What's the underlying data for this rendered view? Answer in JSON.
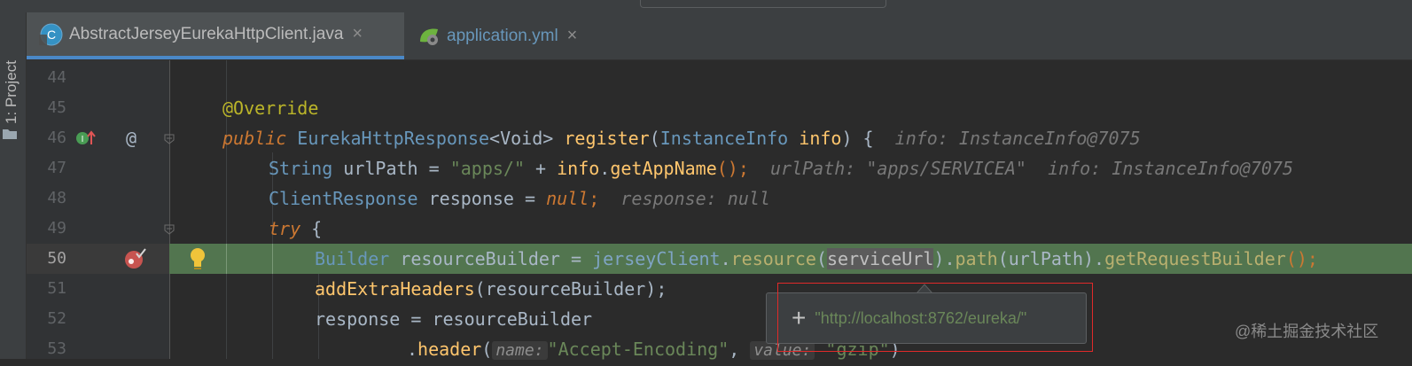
{
  "side": {
    "project_tab": "1: Project"
  },
  "tabs": [
    {
      "label": "AbstractJerseyEurekaHttpClient.java",
      "icon": "java-class-icon",
      "active": true
    },
    {
      "label": "application.yml",
      "icon": "spring-boot-yml-icon",
      "active": false
    }
  ],
  "tab_close": "×",
  "lines": {
    "l44": "44",
    "l45": "45",
    "l46": "46",
    "l47": "47",
    "l48": "48",
    "l49": "49",
    "l50": "50",
    "l51": "51",
    "l52": "52",
    "l53": "53"
  },
  "code": {
    "override": "@Override",
    "l46": {
      "public": "public",
      "type": "EurekaHttpResponse",
      "lt": "<",
      "void": "Void",
      "gt": "> ",
      "name": "register",
      "open": "(",
      "ptype": "InstanceInfo",
      "pname": "info",
      "close": ") {",
      "hint": "info: InstanceInfo@7075"
    },
    "l47": {
      "type": "String",
      "rest1": " urlPath = ",
      "str": "\"apps/\"",
      "rest2": " + ",
      "obj": "info",
      "dot": ".",
      "m": "getAppName",
      "end": "();",
      "hint1": "urlPath: \"apps/SERVICEA\"",
      "hint2": "info: InstanceInfo@7075"
    },
    "l48": {
      "type": "ClientResponse",
      "rest": " response = ",
      "null": "null",
      "semi": ";",
      "hint": "response: null"
    },
    "l49": {
      "try": "try",
      "brace": " {"
    },
    "l50": {
      "type": "Builder",
      "rest": " resourceBuilder = ",
      "field": "jerseyClient",
      "dot1": ".",
      "m1": "resource",
      "p1": "(",
      "arg": "serviceUrl",
      "p2": ").",
      "m2": "path",
      "p3": "(urlPath).",
      "m3": "getRequestBuilder",
      "end": "();"
    },
    "l51": {
      "m": "addExtraHeaders",
      "rest": "(resourceBuilder);"
    },
    "l52": {
      "text": "response = resourceBuilder"
    },
    "l53": {
      "dot": ".",
      "m": "header",
      "p1": "(",
      "h1": "name:",
      "s1": "\"Accept-Encoding\"",
      "comma": ", ",
      "h2": "value:",
      "s2": "\"gzip\"",
      "end": ")"
    }
  },
  "popup": {
    "plus": "+",
    "value": "\"http://localhost:8762/eureka/\""
  },
  "watermark": "@稀土掘金技术社区",
  "colors": {
    "editor_bg": "#2b2b2b",
    "exec_line": "#52754f",
    "keyword": "#cc7832",
    "string": "#6a8759",
    "method": "#ffc66d",
    "annotation": "#bbb529",
    "type": "#6897bb"
  }
}
